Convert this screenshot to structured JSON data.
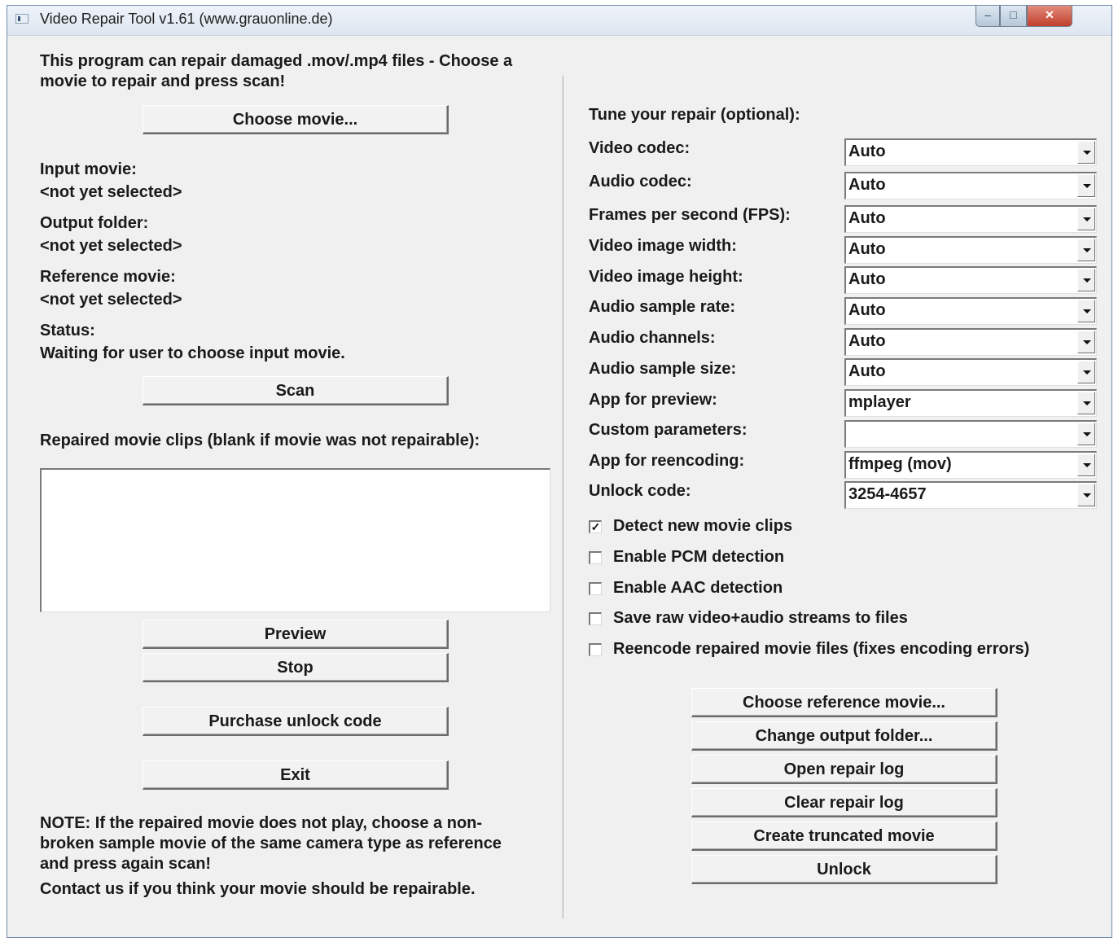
{
  "window": {
    "title": "Video Repair Tool v1.61 (www.grauonline.de)",
    "controls": {
      "minimize": "–",
      "maximize": "□",
      "close": "✕"
    }
  },
  "left": {
    "intro": "This program can repair damaged .mov/.mp4 files - Choose a movie to repair and press scan!",
    "choose_movie_button": "Choose movie...",
    "input_movie_label": "Input movie:",
    "input_movie_value": "<not yet selected>",
    "output_folder_label": "Output folder:",
    "output_folder_value": "<not yet selected>",
    "reference_movie_label": "Reference movie:",
    "reference_movie_value": "<not yet selected>",
    "status_label": "Status:",
    "status_value": "Waiting for user to choose input movie.",
    "scan_button": "Scan",
    "repaired_clips_label": "Repaired movie clips (blank if movie was not repairable):",
    "repaired_clips_items": [],
    "preview_button": "Preview",
    "stop_button": "Stop",
    "purchase_button": "Purchase unlock code",
    "exit_button": "Exit",
    "note": "NOTE: If the repaired movie does not play, choose a non-broken sample movie of the same camera type as reference and press again scan!",
    "contact": "Contact us if you think your movie should be repairable."
  },
  "right": {
    "tune_heading": "Tune your repair (optional):",
    "settings": [
      {
        "label": "Video codec:",
        "value": "Auto"
      },
      {
        "label": "Audio codec:",
        "value": "Auto"
      },
      {
        "label": "Frames per second (FPS):",
        "value": "Auto"
      },
      {
        "label": "Video image width:",
        "value": "Auto"
      },
      {
        "label": "Video image height:",
        "value": "Auto"
      },
      {
        "label": "Audio sample rate:",
        "value": "Auto"
      },
      {
        "label": "Audio channels:",
        "value": "Auto"
      },
      {
        "label": "Audio sample size:",
        "value": "Auto"
      },
      {
        "label": "App for preview:",
        "value": "mplayer"
      },
      {
        "label": "Custom parameters:",
        "value": ""
      },
      {
        "label": "App for reencoding:",
        "value": "ffmpeg (mov)"
      },
      {
        "label": "Unlock code:",
        "value": "3254-4657"
      }
    ],
    "checkboxes": [
      {
        "label": "Detect new movie clips",
        "checked": true
      },
      {
        "label": "Enable PCM detection",
        "checked": false
      },
      {
        "label": "Enable AAC detection",
        "checked": false
      },
      {
        "label": "Save raw video+audio streams to files",
        "checked": false
      },
      {
        "label": "Reencode repaired movie files (fixes encoding errors)",
        "checked": false
      }
    ],
    "buttons": {
      "choose_reference": "Choose reference movie...",
      "change_output": "Change output folder...",
      "open_log": "Open repair log",
      "clear_log": "Clear repair log",
      "create_truncated": "Create truncated movie",
      "unlock": "Unlock"
    }
  }
}
